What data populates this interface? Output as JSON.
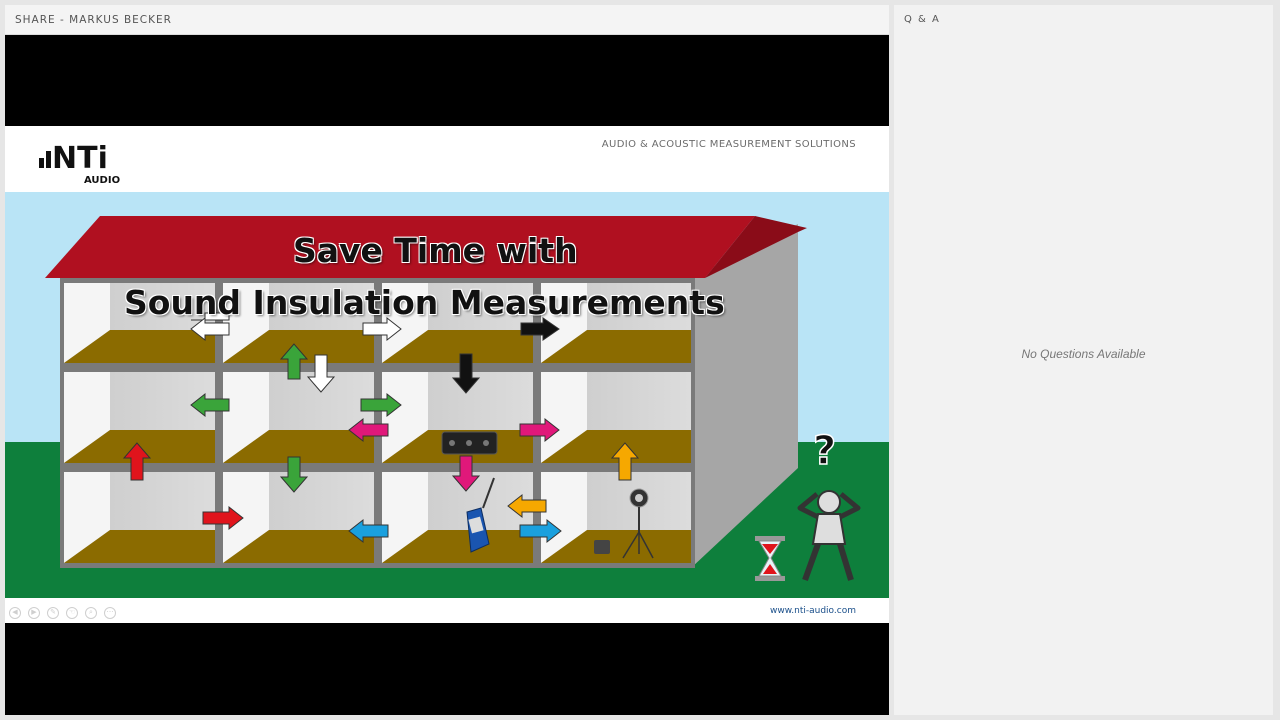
{
  "share": {
    "title": "SHARE  - MARKUS BECKER"
  },
  "slide": {
    "brand_mark": "NTi",
    "brand_sub": "AUDIO",
    "tagline": "AUDIO & ACOUSTIC MEASUREMENT SOLUTIONS",
    "title_line_1": "Save Time with",
    "title_line_2": "Sound Insulation Measurements",
    "question_mark": "?",
    "footer_url": "www.nti-audio.com",
    "controls": [
      "prev-icon",
      "play-icon",
      "pen-icon",
      "pointer-icon",
      "zoom-icon",
      "more-icon"
    ]
  },
  "qa": {
    "title": "Q & A",
    "empty_message": "No Questions Available"
  },
  "colors": {
    "sky": "#b9e4f6",
    "grass": "#0e7f3c",
    "roof": "#b01020",
    "floor": "#8b6b00",
    "arrow_green": "#3aa43a",
    "arrow_red": "#e0141c",
    "arrow_pink": "#e0187a",
    "arrow_blue": "#1aa0de",
    "arrow_orange": "#f6a800"
  }
}
